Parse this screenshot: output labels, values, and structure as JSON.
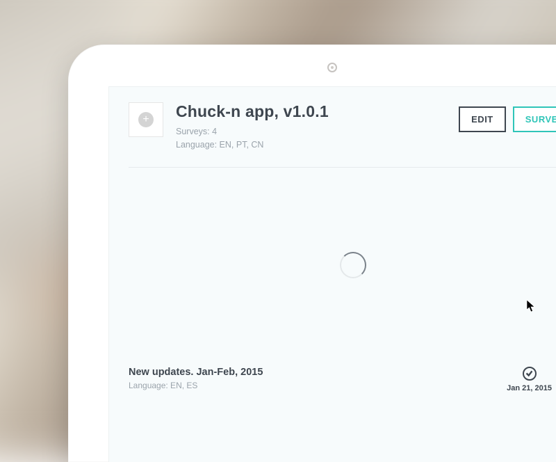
{
  "header": {
    "title": "Chuck-n app, v1.0.1",
    "surveys_label": "Surveys: 4",
    "language_label": "Language: EN, PT, CN",
    "edit_label": "EDIT",
    "survey_label": "SURVEY"
  },
  "footer": {
    "title": "New updates. Jan-Feb, 2015",
    "language_label": "Language: EN, ES",
    "date": "Jan 21, 2015"
  },
  "colors": {
    "accent": "#2fc5b8",
    "text_dark": "#3e464f",
    "text_muted": "#9aa3ab"
  }
}
